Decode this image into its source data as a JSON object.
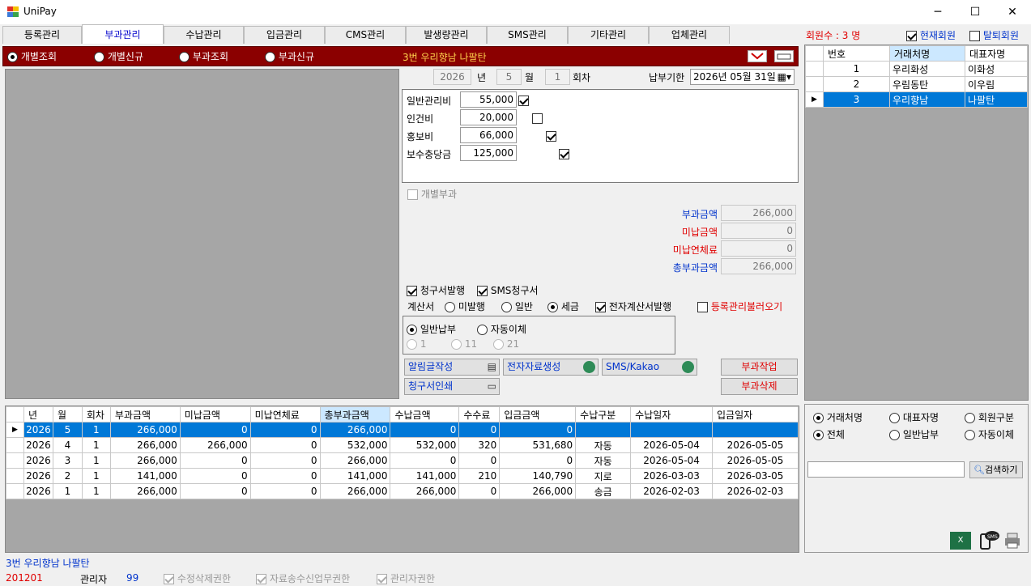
{
  "window": {
    "title": "UniPay",
    "minimize": "─",
    "maximize": "☐",
    "close": "✕"
  },
  "tabs": [
    "등록관리",
    "부과관리",
    "수납관리",
    "입금관리",
    "CMS관리",
    "발생량관리",
    "SMS관리",
    "기타관리",
    "업체관리"
  ],
  "member_count": "회원수 : 3 명",
  "current_member": "현재회원",
  "withdrawn_member": "탈퇴회원",
  "mode_radios": [
    "개별조회",
    "개별신규",
    "부과조회",
    "부과신규"
  ],
  "selected_member_title": "3번 우리향남 나팔탄",
  "period": {
    "year": "2026",
    "year_label": "년",
    "month": "5",
    "month_label": "월",
    "round": "1",
    "round_label": "회차",
    "due_label": "납부기한",
    "due_date": "2026년 05월 31일"
  },
  "fees": [
    {
      "label": "일반관리비",
      "amount": "55,000",
      "checked": true
    },
    {
      "label": "인건비",
      "amount": "20,000",
      "checked": false
    },
    {
      "label": "홍보비",
      "amount": "66,000",
      "checked": true
    },
    {
      "label": "보수충당금",
      "amount": "125,000",
      "checked": true
    }
  ],
  "individual_charge": "개별부과",
  "summary": [
    {
      "label": "부과금액",
      "value": "266,000",
      "color": "blue"
    },
    {
      "label": "미납금액",
      "value": "0",
      "color": "red"
    },
    {
      "label": "미납연체료",
      "value": "0",
      "color": "red"
    },
    {
      "label": "총부과금액",
      "value": "266,000",
      "color": "blue"
    }
  ],
  "options": {
    "invoice_issue": "청구서발행",
    "sms_invoice": "SMS청구서",
    "statement_label": "계산서",
    "no_issue": "미발행",
    "general": "일반",
    "tax": "세금",
    "e_tax_invoice": "전자계산서발행",
    "load_registration": "등록관리불러오기",
    "general_pay": "일반납부",
    "auto_transfer": "자동이체",
    "days": [
      "1",
      "11",
      "21"
    ]
  },
  "buttons": {
    "write_notice": "알림글작성",
    "create_edata": "전자자료생성",
    "sms_kakao": "SMS/Kakao",
    "charge_work": "부과작업",
    "print_invoice": "청구서인쇄",
    "delete_charge": "부과삭제",
    "search": "검색하기"
  },
  "member_table": {
    "headers": [
      "번호",
      "거래처명",
      "대표자명"
    ],
    "rows": [
      [
        "1",
        "우리화성",
        "이화성"
      ],
      [
        "2",
        "우림동탄",
        "이우림"
      ],
      [
        "3",
        "우리향남",
        "나팔탄"
      ]
    ],
    "selected": 2
  },
  "charge_table": {
    "headers": [
      "년",
      "월",
      "회차",
      "부과금액",
      "미납금액",
      "미납연체료",
      "총부과금액",
      "수납금액",
      "수수료",
      "입금금액",
      "수납구분",
      "수납일자",
      "입금일자"
    ],
    "rows": [
      [
        "2026",
        "5",
        "1",
        "266,000",
        "0",
        "0",
        "266,000",
        "0",
        "0",
        "0",
        "",
        "",
        ""
      ],
      [
        "2026",
        "4",
        "1",
        "266,000",
        "266,000",
        "0",
        "532,000",
        "532,000",
        "320",
        "531,680",
        "자동",
        "2026-05-04",
        "2026-05-05"
      ],
      [
        "2026",
        "3",
        "1",
        "266,000",
        "0",
        "0",
        "266,000",
        "0",
        "0",
        "0",
        "자동",
        "2026-05-04",
        "2026-05-05"
      ],
      [
        "2026",
        "2",
        "1",
        "141,000",
        "0",
        "0",
        "141,000",
        "141,000",
        "210",
        "140,790",
        "지로",
        "2026-03-03",
        "2026-03-05"
      ],
      [
        "2026",
        "1",
        "1",
        "266,000",
        "0",
        "0",
        "266,000",
        "266,000",
        "0",
        "266,000",
        "송금",
        "2026-02-03",
        "2026-02-03"
      ]
    ],
    "selected": 0
  },
  "search_filters": {
    "by": [
      "거래처명",
      "대표자명",
      "회원구분"
    ],
    "pay": [
      "전체",
      "일반납부",
      "자동이체"
    ]
  },
  "status": {
    "member": "3번 우리향남 나팔탄",
    "code": "201201",
    "role_label": "관리자",
    "role_value": "99",
    "perm1": "수정삭제권한",
    "perm2": "자료송수신업무권한",
    "perm3": "관리자권한"
  },
  "colors": {
    "accent": "#0078d7",
    "dark_red": "#8b0000",
    "red": "#e00000",
    "blue": "#0033cc"
  }
}
